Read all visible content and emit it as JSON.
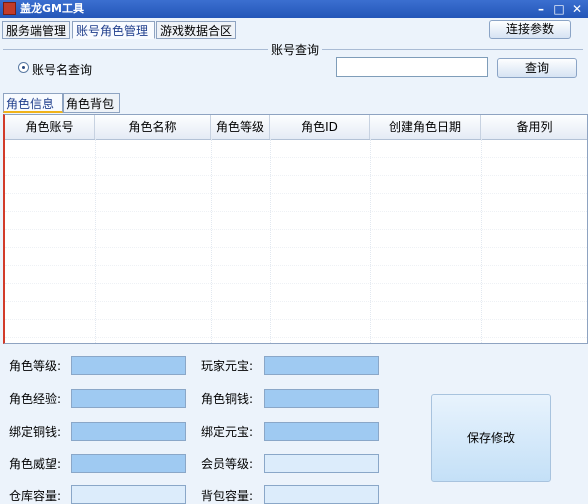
{
  "window": {
    "title": "盖龙GM工具",
    "controls": [
      "–",
      "□",
      "✕"
    ]
  },
  "main_tabs": [
    {
      "label": "服务端管理"
    },
    {
      "label": "账号角色管理"
    },
    {
      "label": "游戏数据合区"
    }
  ],
  "connect_button": "连接参数",
  "query": {
    "group_title": "账号查询",
    "radio_label": "账号名查询",
    "input_value": "",
    "button_label": "查询"
  },
  "sub_tabs": [
    {
      "label": "角色信息"
    },
    {
      "label": "角色背包"
    }
  ],
  "table": {
    "columns": [
      "角色账号",
      "角色名称",
      "角色等级",
      "角色ID",
      "创建角色日期",
      "备用列"
    ],
    "rows": []
  },
  "form": {
    "role_level": "角色等级:",
    "player_ingot": "玩家元宝:",
    "role_exp": "角色经验:",
    "role_copper": "角色铜钱:",
    "bound_copper": "绑定铜钱:",
    "bound_ingot": "绑定元宝:",
    "role_prestige": "角色威望:",
    "vip_level": "会员等级:",
    "warehouse_capacity": "仓库容量:",
    "bag_capacity": "背包容量:"
  },
  "save_button": "保存修改"
}
